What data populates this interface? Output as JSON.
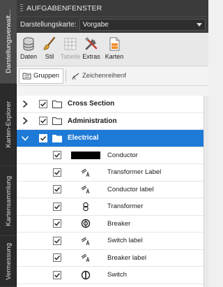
{
  "side_tabs": [
    {
      "label": "Darstellungsverwalt...",
      "active": true
    },
    {
      "label": "Karten-Explorer",
      "active": false
    },
    {
      "label": "Kartensammlung",
      "active": false
    },
    {
      "label": "Vermessung",
      "active": false
    }
  ],
  "window": {
    "title": "AUFGABENFENSTER"
  },
  "map_selector": {
    "label": "Darstellungskarte:",
    "value": "Vorgabe"
  },
  "toolbar": {
    "items": [
      {
        "label": "Daten",
        "icon": "database-icon",
        "enabled": true
      },
      {
        "label": "Stil",
        "icon": "brush-icon",
        "enabled": true
      },
      {
        "label": "Tabelle",
        "icon": "table-icon",
        "enabled": false
      },
      {
        "label": "Extras",
        "icon": "tools-icon",
        "enabled": true
      },
      {
        "label": "Karten",
        "icon": "map-sheet-icon",
        "enabled": true
      }
    ]
  },
  "subtabs": [
    {
      "label": "Gruppen",
      "active": true
    },
    {
      "label": "Zeichenreihenf",
      "active": false
    }
  ],
  "tree": {
    "groups": [
      {
        "name": "Cross Section",
        "expanded": false,
        "checked": true
      },
      {
        "name": "Administration",
        "expanded": false,
        "checked": true
      },
      {
        "name": "Electrical",
        "expanded": true,
        "checked": true,
        "selected": true
      }
    ],
    "children": [
      {
        "name": "Conductor",
        "symbol": "black-bar-icon",
        "checked": true
      },
      {
        "name": "Transformer Label",
        "symbol": "label-style-icon",
        "checked": true
      },
      {
        "name": "Conductor label",
        "symbol": "label-style-icon",
        "checked": true
      },
      {
        "name": "Transformer",
        "symbol": "transformer-icon",
        "checked": true
      },
      {
        "name": "Breaker",
        "symbol": "breaker-icon",
        "checked": true
      },
      {
        "name": "Switch label",
        "symbol": "label-style-icon",
        "checked": true
      },
      {
        "name": "Breaker label",
        "symbol": "label-style-icon",
        "checked": true
      },
      {
        "name": "Switch",
        "symbol": "switch-icon",
        "checked": true
      }
    ]
  },
  "colors": {
    "selection": "#1e7ad7",
    "header_bg": "#3b3b3b",
    "strip_bg": "#2b2b2b"
  }
}
